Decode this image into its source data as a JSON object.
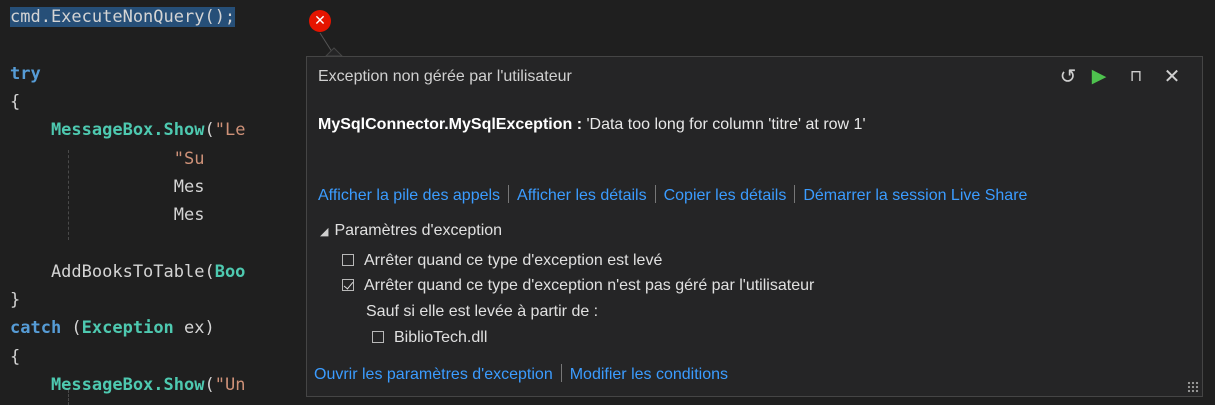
{
  "editor": {
    "colors": {
      "background": "#1f1f1f",
      "keyword": "#569cd6",
      "method": "#4ec9b0",
      "string": "#ce9178",
      "plain": "#d4d4d4",
      "selection": "#264f78"
    },
    "lines": [
      {
        "tokens": [
          {
            "text": "cmd.ExecuteNonQuery();",
            "kind": "plain",
            "highlight": true
          }
        ]
      },
      {
        "tokens": []
      },
      {
        "tokens": [
          {
            "text": "try",
            "kind": "keyword"
          }
        ]
      },
      {
        "tokens": [
          {
            "text": "{",
            "kind": "plain"
          }
        ]
      },
      {
        "tokens": [
          {
            "text": "    MessageBox.",
            "kind": "method"
          },
          {
            "text": "Show",
            "kind": "method"
          },
          {
            "text": "(",
            "kind": "plain"
          },
          {
            "text": "\"Le",
            "kind": "string"
          }
        ]
      },
      {
        "tokens": [
          {
            "text": "                ",
            "kind": "plain"
          },
          {
            "text": "\"Su",
            "kind": "string"
          }
        ]
      },
      {
        "tokens": [
          {
            "text": "                Mes",
            "kind": "plain"
          }
        ]
      },
      {
        "tokens": [
          {
            "text": "                Mes",
            "kind": "plain"
          }
        ]
      },
      {
        "tokens": []
      },
      {
        "tokens": [
          {
            "text": "    AddBooksToTable(",
            "kind": "plain"
          },
          {
            "text": "Boo",
            "kind": "method"
          }
        ]
      },
      {
        "tokens": [
          {
            "text": "}",
            "kind": "plain"
          }
        ]
      },
      {
        "tokens": [
          {
            "text": "catch",
            "kind": "keyword"
          },
          {
            "text": " (",
            "kind": "plain"
          },
          {
            "text": "Exception",
            "kind": "method"
          },
          {
            "text": " ex)",
            "kind": "plain"
          }
        ]
      },
      {
        "tokens": [
          {
            "text": "{",
            "kind": "plain"
          }
        ]
      },
      {
        "tokens": [
          {
            "text": "    MessageBox.",
            "kind": "method"
          },
          {
            "text": "Show",
            "kind": "method"
          },
          {
            "text": "(",
            "kind": "plain"
          },
          {
            "text": "\"Un",
            "kind": "string"
          }
        ]
      }
    ]
  },
  "error_badge": {
    "glyph": "✕",
    "color": "#e51400"
  },
  "popup": {
    "title": "Exception non gérée par l'utilisateur",
    "buttons": {
      "history_glyph": "↺",
      "continue_glyph": "▶",
      "pin_glyph": "⊓",
      "close_glyph": "✕"
    },
    "exception_type": "MySqlConnector.MySqlException :",
    "exception_message": " 'Data too long for column 'titre' at row 1'",
    "links": [
      "Afficher la pile des appels",
      "Afficher les détails",
      "Copier les détails",
      "Démarrer la session Live Share"
    ],
    "section_title": "Paramètres d'exception",
    "options": [
      {
        "label": "Arrêter quand ce type d'exception est levé",
        "checked": false
      },
      {
        "label": "Arrêter quand ce type d'exception n'est pas géré par l'utilisateur",
        "checked": true
      }
    ],
    "except_label": "Sauf si elle est levée à partir de :",
    "module_option": {
      "label": "BiblioTech.dll",
      "checked": false
    },
    "bottom_links": [
      "Ouvrir les paramètres d'exception",
      "Modifier les conditions"
    ],
    "colors": {
      "link": "#3b9cff",
      "continue": "#4ec24e",
      "background": "#252526"
    }
  }
}
